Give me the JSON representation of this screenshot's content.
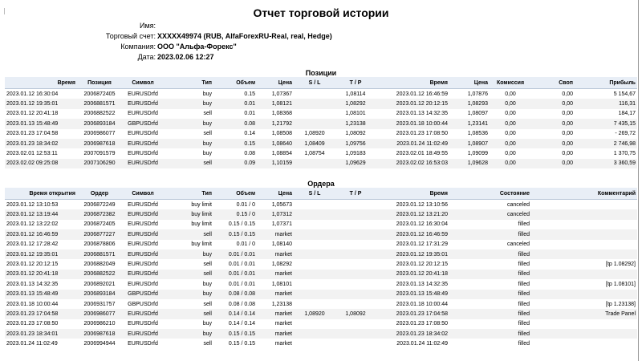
{
  "report_title": "Отчет торговой истории",
  "info": {
    "name_label": "Имя:",
    "name_value": "",
    "account_label": "Торговый счет:",
    "account_value": "XXXXX49974 (RUB, AlfaForexRU-Real, real, Hedge)",
    "company_label": "Компания:",
    "company_value": "ООО \"Альфа-Форекс\"",
    "date_label": "Дата:",
    "date_value": "2023.02.06 12:27"
  },
  "positions": {
    "title": "Позиции",
    "headers": [
      "Время",
      "Позиция",
      "Символ",
      "Тип",
      "Объем",
      "Цена",
      "S / L",
      "T / P",
      "Время",
      "Цена",
      "Комиссия",
      "Своп",
      "Прибыль"
    ],
    "rows": [
      [
        "2023.01.12 16:30:04",
        "2006872405",
        "EURUSDrfd",
        "buy",
        "0.15",
        "1,07367",
        "",
        "1,08114",
        "2023.01.12 16:46:59",
        "1,07876",
        "0,00",
        "0,00",
        "5 154,67"
      ],
      [
        "2023.01.12 19:35:01",
        "2006881571",
        "EURUSDrfd",
        "buy",
        "0.01",
        "1,08121",
        "",
        "1,08292",
        "2023.01.12 20:12:15",
        "1,08293",
        "0,00",
        "0,00",
        "116,31"
      ],
      [
        "2023.01.12 20:41:18",
        "2006882522",
        "EURUSDrfd",
        "sell",
        "0.01",
        "1,08368",
        "",
        "1,08101",
        "2023.01.13 14:32:35",
        "1,08097",
        "0,00",
        "0,00",
        "184,17"
      ],
      [
        "2023.01.13 15:48:49",
        "2006893184",
        "GBPUSDrfd",
        "buy",
        "0.08",
        "1,21792",
        "",
        "1,23138",
        "2023.01.18 10:00:44",
        "1,23141",
        "0,00",
        "0,00",
        "7 435,15"
      ],
      [
        "2023.01.23 17:04:58",
        "2006986077",
        "EURUSDrfd",
        "sell",
        "0.14",
        "1,08508",
        "1,08920",
        "1,08092",
        "2023.01.23 17:08:50",
        "1,08536",
        "0,00",
        "0,00",
        "- 269,72"
      ],
      [
        "2023.01.23 18:34:02",
        "2006987618",
        "EURUSDrfd",
        "buy",
        "0.15",
        "1,08640",
        "1,08409",
        "1,09756",
        "2023.01.24 11:02:49",
        "1,08907",
        "0,00",
        "0,00",
        "2 746,98"
      ],
      [
        "2023.02.01 12:53:11",
        "2007091579",
        "EURUSDrfd",
        "buy",
        "0.08",
        "1,08854",
        "1,08754",
        "1,09183",
        "2023.02.01 18:49:55",
        "1,09099",
        "0,00",
        "0,00",
        "1 370,75"
      ],
      [
        "2023.02.02 09:25:08",
        "2007106290",
        "EURUSDrfd",
        "sell",
        "0.09",
        "1,10159",
        "",
        "1,09629",
        "2023.02.02 16:53:03",
        "1,09628",
        "0,00",
        "0,00",
        "3 360,59"
      ]
    ]
  },
  "orders": {
    "title": "Ордера",
    "headers": [
      "Время открытия",
      "Ордер",
      "Символ",
      "Тип",
      "Объем",
      "Цена",
      "S / L",
      "T / P",
      "Время",
      "Состояние",
      "Комментарий"
    ],
    "rows": [
      [
        "2023.01.12 13:10:53",
        "2006872249",
        "EURUSDrfd",
        "buy limit",
        "0.01 / 0",
        "1,05673",
        "",
        "",
        "2023.01.12 13:10:56",
        "canceled",
        ""
      ],
      [
        "2023.01.12 13:19:44",
        "2006872382",
        "EURUSDrfd",
        "buy limit",
        "0.15 / 0",
        "1,07312",
        "",
        "",
        "2023.01.12 13:21:20",
        "canceled",
        ""
      ],
      [
        "2023.01.12 13:22:02",
        "2006872405",
        "EURUSDrfd",
        "buy limit",
        "0.15 / 0.15",
        "1,07371",
        "",
        "",
        "2023.01.12 16:30:04",
        "filled",
        ""
      ],
      [
        "2023.01.12 16:46:59",
        "2006877227",
        "EURUSDrfd",
        "sell",
        "0.15 / 0.15",
        "market",
        "",
        "",
        "2023.01.12 16:46:59",
        "filled",
        ""
      ],
      [
        "2023.01.12 17:28:42",
        "2006878806",
        "EURUSDrfd",
        "buy limit",
        "0.01 / 0",
        "1,08140",
        "",
        "",
        "2023.01.12 17:31:29",
        "canceled",
        ""
      ],
      [
        "2023.01.12 19:35:01",
        "2006881571",
        "EURUSDrfd",
        "buy",
        "0.01 / 0.01",
        "market",
        "",
        "",
        "2023.01.12 19:35:01",
        "filled",
        ""
      ],
      [
        "2023.01.12 20:12:15",
        "2006882049",
        "EURUSDrfd",
        "sell",
        "0.01 / 0.01",
        "1,08292",
        "",
        "",
        "2023.01.12 20:12:15",
        "filled",
        "[tp 1.08292]"
      ],
      [
        "2023.01.12 20:41:18",
        "2006882522",
        "EURUSDrfd",
        "sell",
        "0.01 / 0.01",
        "market",
        "",
        "",
        "2023.01.12 20:41:18",
        "filled",
        ""
      ],
      [
        "2023.01.13 14:32:35",
        "2006892021",
        "EURUSDrfd",
        "buy",
        "0.01 / 0.01",
        "1,08101",
        "",
        "",
        "2023.01.13 14:32:35",
        "filled",
        "[tp 1.08101]"
      ],
      [
        "2023.01.13 15:48:49",
        "2006893184",
        "GBPUSDrfd",
        "buy",
        "0.08 / 0.08",
        "market",
        "",
        "",
        "2023.01.13 15:48:49",
        "filled",
        ""
      ],
      [
        "2023.01.18 10:00:44",
        "2006931757",
        "GBPUSDrfd",
        "sell",
        "0.08 / 0.08",
        "1,23138",
        "",
        "",
        "2023.01.18 10:00:44",
        "filled",
        "[tp 1.23138]"
      ],
      [
        "2023.01.23 17:04:58",
        "2006986077",
        "EURUSDrfd",
        "sell",
        "0.14 / 0.14",
        "market",
        "1,08920",
        "1,08092",
        "2023.01.23 17:04:58",
        "filled",
        "Trade Panel"
      ],
      [
        "2023.01.23 17:08:50",
        "2006986210",
        "EURUSDrfd",
        "buy",
        "0.14 / 0.14",
        "market",
        "",
        "",
        "2023.01.23 17:08:50",
        "filled",
        ""
      ],
      [
        "2023.01.23 18:34:01",
        "2006987618",
        "EURUSDrfd",
        "buy",
        "0.15 / 0.15",
        "market",
        "",
        "",
        "2023.01.23 18:34:02",
        "filled",
        ""
      ],
      [
        "2023.01.24 11:02:49",
        "2006994944",
        "EURUSDrfd",
        "sell",
        "0.15 / 0.15",
        "market",
        "",
        "",
        "2023.01.24 11:02:49",
        "filled",
        ""
      ]
    ]
  }
}
